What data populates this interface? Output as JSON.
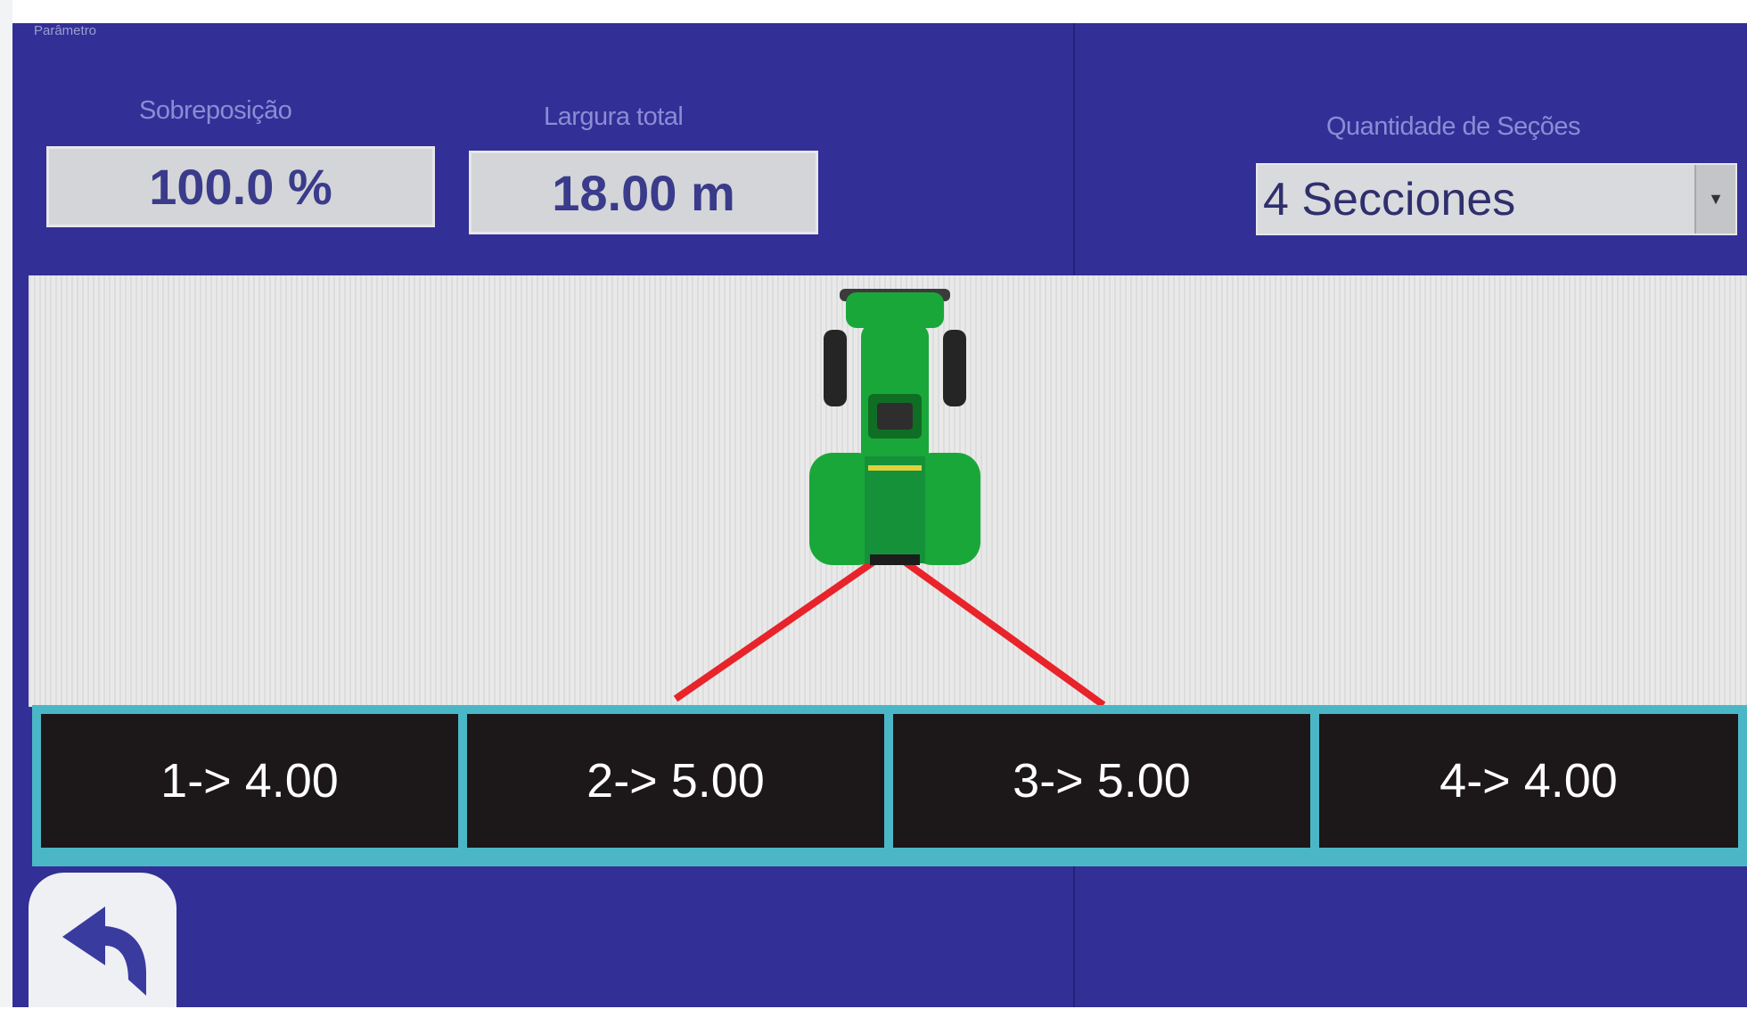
{
  "window": {
    "title": "Parâmetro"
  },
  "overlap": {
    "label": "Sobreposição",
    "value": "100.0 %"
  },
  "total_width": {
    "label": "Largura total",
    "value": "18.00 m"
  },
  "section_count": {
    "label": "Quantidade de Seções",
    "selected": "4 Secciones"
  },
  "sections": [
    {
      "label": "1-> 4.00"
    },
    {
      "label": "2-> 5.00"
    },
    {
      "label": "3-> 5.00"
    },
    {
      "label": "4-> 4.00"
    }
  ],
  "icons": {
    "back": "back-arrow-icon",
    "tractor": "tractor-icon",
    "dropdown": "chevron-down-icon"
  },
  "colors": {
    "background": "#322f96",
    "label": "#8c8cd6",
    "input_text": "#3a3b8a",
    "section_bg": "#1c1718",
    "section_border": "#4bb7c6",
    "boom_line": "#e8232a",
    "tractor": "#1aa73a"
  }
}
